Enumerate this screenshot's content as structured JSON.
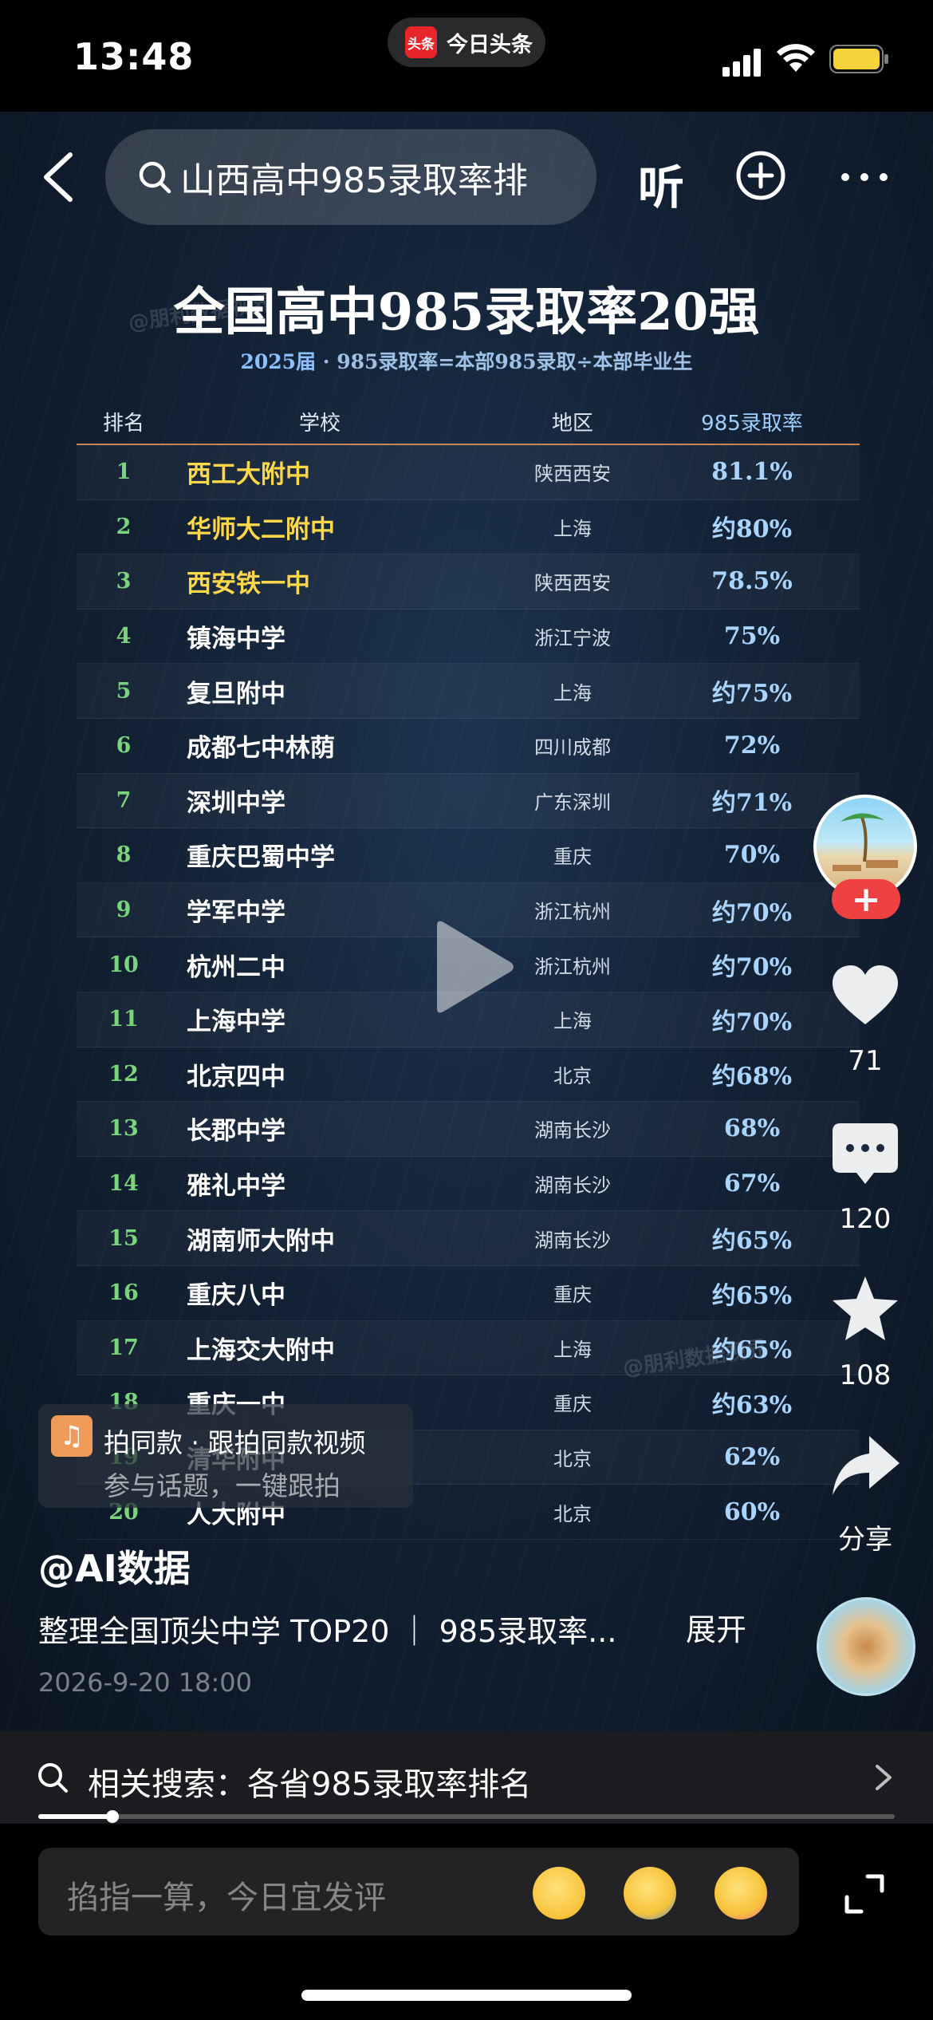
{
  "status_bar": {
    "time": "13:48",
    "app_logo_text": "头条",
    "app_name": "今日头条"
  },
  "nav": {
    "search_text": "山西高中985录取率排",
    "listen_label": "听"
  },
  "chart_data": {
    "type": "table",
    "title": "全国高中985录取率20强",
    "subtitle_year": "2025届",
    "subtitle_rest": " · 985录取率=本部985录取÷本部毕业生",
    "columns": [
      "排名",
      "学校",
      "地区",
      "985录取率"
    ],
    "rows": [
      {
        "rank": "1",
        "school": "西工大附中",
        "region": "陕西西安",
        "rate": "81.1%",
        "top": true
      },
      {
        "rank": "2",
        "school": "华师大二附中",
        "region": "上海",
        "rate": "约80%",
        "top": true
      },
      {
        "rank": "3",
        "school": "西安铁一中",
        "region": "陕西西安",
        "rate": "78.5%",
        "top": true
      },
      {
        "rank": "4",
        "school": "镇海中学",
        "region": "浙江宁波",
        "rate": "75%"
      },
      {
        "rank": "5",
        "school": "复旦附中",
        "region": "上海",
        "rate": "约75%"
      },
      {
        "rank": "6",
        "school": "成都七中林荫",
        "region": "四川成都",
        "rate": "72%"
      },
      {
        "rank": "7",
        "school": "深圳中学",
        "region": "广东深圳",
        "rate": "约71%"
      },
      {
        "rank": "8",
        "school": "重庆巴蜀中学",
        "region": "重庆",
        "rate": "70%"
      },
      {
        "rank": "9",
        "school": "学军中学",
        "region": "浙江杭州",
        "rate": "约70%"
      },
      {
        "rank": "10",
        "school": "杭州二中",
        "region": "浙江杭州",
        "rate": "约70%"
      },
      {
        "rank": "11",
        "school": "上海中学",
        "region": "上海",
        "rate": "约70%"
      },
      {
        "rank": "12",
        "school": "北京四中",
        "region": "北京",
        "rate": "约68%"
      },
      {
        "rank": "13",
        "school": "长郡中学",
        "region": "湖南长沙",
        "rate": "68%"
      },
      {
        "rank": "14",
        "school": "雅礼中学",
        "region": "湖南长沙",
        "rate": "67%"
      },
      {
        "rank": "15",
        "school": "湖南师大附中",
        "region": "湖南长沙",
        "rate": "约65%"
      },
      {
        "rank": "16",
        "school": "重庆八中",
        "region": "重庆",
        "rate": "约65%"
      },
      {
        "rank": "17",
        "school": "上海交大附中",
        "region": "上海",
        "rate": "约65%"
      },
      {
        "rank": "18",
        "school": "重庆一中",
        "region": "重庆",
        "rate": "约63%"
      },
      {
        "rank": "19",
        "school": "清华附中",
        "region": "北京",
        "rate": "62%"
      },
      {
        "rank": "20",
        "school": "人大附中",
        "region": "北京",
        "rate": "60%"
      }
    ]
  },
  "watermark": {
    "text": "@朋利数据视界"
  },
  "same_style": {
    "title": "拍同款 · 跟拍同款视频",
    "subtitle": "参与话题，一键跟拍"
  },
  "rail": {
    "likes": "71",
    "comments": "120",
    "favorites": "108",
    "share_label": "分享"
  },
  "post": {
    "author": "@AI数据",
    "description": "整理全国顶尖中学 TOP20 ｜ 985录取率...",
    "expand_label": "展开",
    "date": "2026-9-20 18:00"
  },
  "related": {
    "text": "相关搜索：各省985录取率排名"
  },
  "progress": {
    "fraction": 0.087
  },
  "comment": {
    "placeholder": "掐指一算，今日宜发评"
  }
}
